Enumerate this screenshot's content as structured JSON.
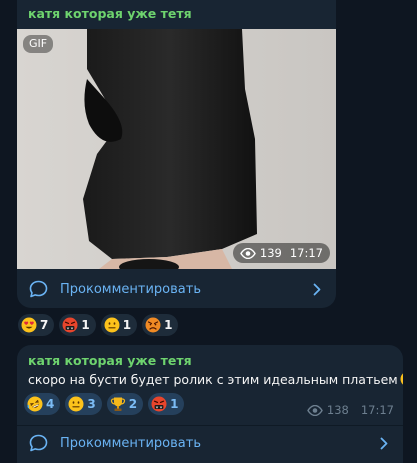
{
  "posts": [
    {
      "author": "катя которая уже тетя",
      "media_badge": "GIF",
      "views": "139",
      "time": "17:17",
      "comment_label": "Прокомментировать"
    },
    {
      "author": "катя которая уже тетя",
      "text": "скоро на бусти будет ролик с этим идеальным платьем",
      "text_emoji": "relieved-face",
      "views": "138",
      "time": "17:17",
      "comment_label": "Прокомментировать"
    }
  ],
  "reactions_post1": [
    {
      "emoji": "heart-eyes-face",
      "count": "7"
    },
    {
      "emoji": "cursing-face",
      "count": "1"
    },
    {
      "emoji": "neutral-face",
      "count": "1"
    },
    {
      "emoji": "angry-face",
      "count": "1"
    }
  ],
  "reactions_post2": [
    {
      "emoji": "rofl-face",
      "count": "4"
    },
    {
      "emoji": "neutral-face",
      "count": "3"
    },
    {
      "emoji": "trophy",
      "count": "2"
    },
    {
      "emoji": "cursing-face",
      "count": "1"
    }
  ],
  "colors": {
    "background": "#0e1621",
    "bubble": "#182533",
    "author": "#6ed36e",
    "link": "#6ab3f3",
    "reaction_selected": "#25405c"
  }
}
